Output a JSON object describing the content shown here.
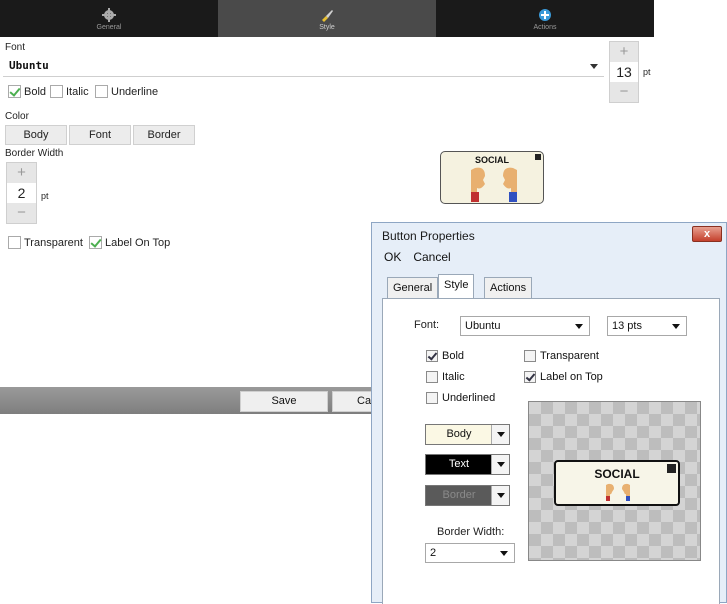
{
  "tabs": [
    {
      "label": "General",
      "icon": "gear-icon"
    },
    {
      "label": "Style",
      "icon": "brush-icon"
    },
    {
      "label": "Actions",
      "icon": "plus-circle-icon"
    }
  ],
  "font": {
    "label": "Font",
    "value": "Ubuntu",
    "size_value": "13",
    "size_unit": "pt",
    "plus": "+",
    "minus": "−"
  },
  "style_options": [
    {
      "label": "Bold",
      "checked": true
    },
    {
      "label": "Italic",
      "checked": false
    },
    {
      "label": "Underline",
      "checked": false
    }
  ],
  "color": {
    "label": "Color",
    "buttons": [
      "Body",
      "Font",
      "Border"
    ]
  },
  "border_width": {
    "label": "Border Width",
    "value": "2",
    "unit": "pt"
  },
  "options2": [
    {
      "label": "Transparent",
      "checked": false
    },
    {
      "label": "Label On Top",
      "checked": true
    }
  ],
  "preview_label": "SOCIAL",
  "bottom": {
    "save": "Save",
    "cancel": "Can"
  },
  "dialog": {
    "title": "Button Properties",
    "close": "x",
    "menu": [
      "OK",
      "Cancel"
    ],
    "tabs": [
      "General",
      "Style",
      "Actions"
    ],
    "font_label": "Font:",
    "font_value": "Ubuntu",
    "size_value": "13 pts",
    "checks_left": [
      {
        "label": "Bold",
        "checked": true
      },
      {
        "label": "Italic",
        "checked": false
      },
      {
        "label": "Underlined",
        "checked": false
      }
    ],
    "checks_right": [
      {
        "label": "Transparent",
        "checked": false
      },
      {
        "label": "Label on Top",
        "checked": true
      }
    ],
    "colors": [
      {
        "label": "Body",
        "bg": "#fbf8e4",
        "fg": "#111111"
      },
      {
        "label": "Text",
        "bg": "#000000",
        "fg": "#ffffff"
      },
      {
        "label": "Border",
        "bg": "#5a5a5a",
        "fg": "#8a8a8a"
      }
    ],
    "border_width_label": "Border Width:",
    "border_width_value": "2",
    "preview_label": "SOCIAL"
  },
  "colors": {
    "checkbox_green": "#4caf50",
    "close_red": "#c4402c"
  }
}
